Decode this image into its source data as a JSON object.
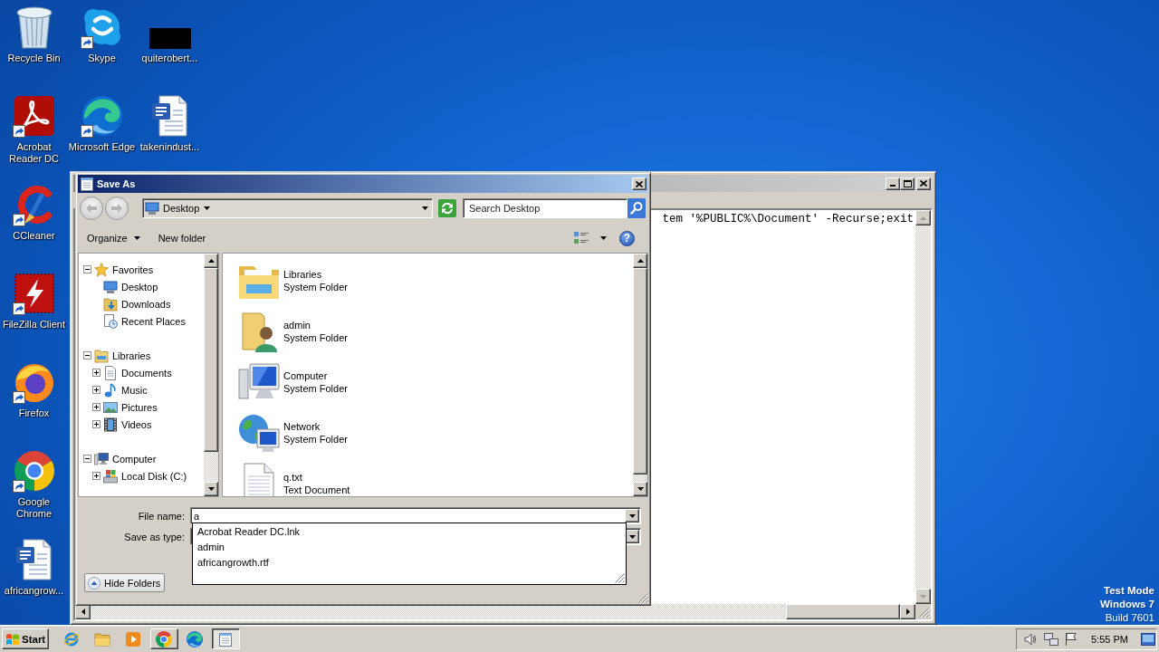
{
  "desktop": {
    "icon_columns": [
      {
        "icons": [
          {
            "label": "Recycle Bin",
            "kind": "recycle-bin",
            "shortcut": false
          },
          {
            "label": "Acrobat Reader DC",
            "kind": "acrobat",
            "shortcut": true
          },
          {
            "label": "CCleaner",
            "kind": "ccleaner",
            "shortcut": true
          },
          {
            "label": "FileZilla Client",
            "kind": "filezilla",
            "shortcut": true
          },
          {
            "label": "Firefox",
            "kind": "firefox",
            "shortcut": true
          },
          {
            "label": "Google Chrome",
            "kind": "chrome",
            "shortcut": true
          },
          {
            "label": "africangrow...",
            "kind": "word-document",
            "shortcut": false
          }
        ]
      },
      {
        "icons": [
          {
            "label": "Skype",
            "kind": "skype",
            "shortcut": true
          },
          {
            "label": "Microsoft Edge",
            "kind": "edge",
            "shortcut": true
          }
        ]
      },
      {
        "icons": [
          {
            "label": "quiterobert...",
            "kind": "thumbnail",
            "shortcut": false
          },
          {
            "label": "takenindust...",
            "kind": "word-document",
            "shortcut": false
          }
        ]
      }
    ],
    "os_notice": [
      {
        "text": "Test Mode",
        "bold": true
      },
      {
        "text": "Windows 7",
        "bold": true
      },
      {
        "text": "Build 7601",
        "bold": false
      }
    ]
  },
  "notepad_window": {
    "text_line": "tem '%PUBLIC%\\Document' -Recurse;exit"
  },
  "save_dialog": {
    "title": "Save As",
    "address": "Desktop",
    "search": {
      "placeholder": "Search Desktop"
    },
    "commands": [
      {
        "label": "Organize",
        "kind": "menu"
      },
      {
        "label": "New folder",
        "kind": "button"
      }
    ],
    "help": "?",
    "nav_tree": [
      {
        "label": "Favorites",
        "kind": "favorites",
        "expanded": true,
        "children": [
          {
            "label": "Desktop",
            "kind": "desktop"
          },
          {
            "label": "Downloads",
            "kind": "downloads"
          },
          {
            "label": "Recent Places",
            "kind": "recent"
          }
        ]
      },
      {
        "label": "Libraries",
        "kind": "libraries",
        "expanded": true,
        "children": [
          {
            "label": "Documents",
            "kind": "documents",
            "expanded": false
          },
          {
            "label": "Music",
            "kind": "music",
            "expanded": false
          },
          {
            "label": "Pictures",
            "kind": "pictures",
            "expanded": false
          },
          {
            "label": "Videos",
            "kind": "videos",
            "expanded": false
          }
        ]
      },
      {
        "label": "Computer",
        "kind": "computer",
        "expanded": true,
        "children": [
          {
            "label": "Local Disk (C:)",
            "kind": "disk",
            "expanded": false
          }
        ]
      }
    ],
    "files": [
      {
        "name": "Libraries",
        "type": "System Folder",
        "kind": "library"
      },
      {
        "name": "admin",
        "type": "System Folder",
        "kind": "user-folder"
      },
      {
        "name": "Computer",
        "type": "System Folder",
        "kind": "computer"
      },
      {
        "name": "Network",
        "type": "System Folder",
        "kind": "network"
      },
      {
        "name": "q.txt",
        "type": "Text Document",
        "kind": "text-file"
      }
    ],
    "file_name": {
      "label": "File name:",
      "value": "a"
    },
    "save_as_type": {
      "label": "Save as type:"
    },
    "autocomplete": [
      "Acrobat Reader DC.lnk",
      "admin",
      "africangrowth.rtf"
    ],
    "hide_folders": "Hide Folders"
  },
  "taskbar": {
    "start": "Start",
    "items": [
      {
        "kind": "internet-explorer",
        "running": false,
        "selected": false
      },
      {
        "kind": "explorer",
        "running": false,
        "selected": false
      },
      {
        "kind": "media-player",
        "running": false,
        "selected": false
      },
      {
        "kind": "chrome",
        "running": true,
        "selected": false
      },
      {
        "kind": "edge",
        "running": false,
        "selected": false
      },
      {
        "kind": "notepad",
        "running": true,
        "selected": true
      }
    ],
    "clock": "5:55 PM"
  }
}
